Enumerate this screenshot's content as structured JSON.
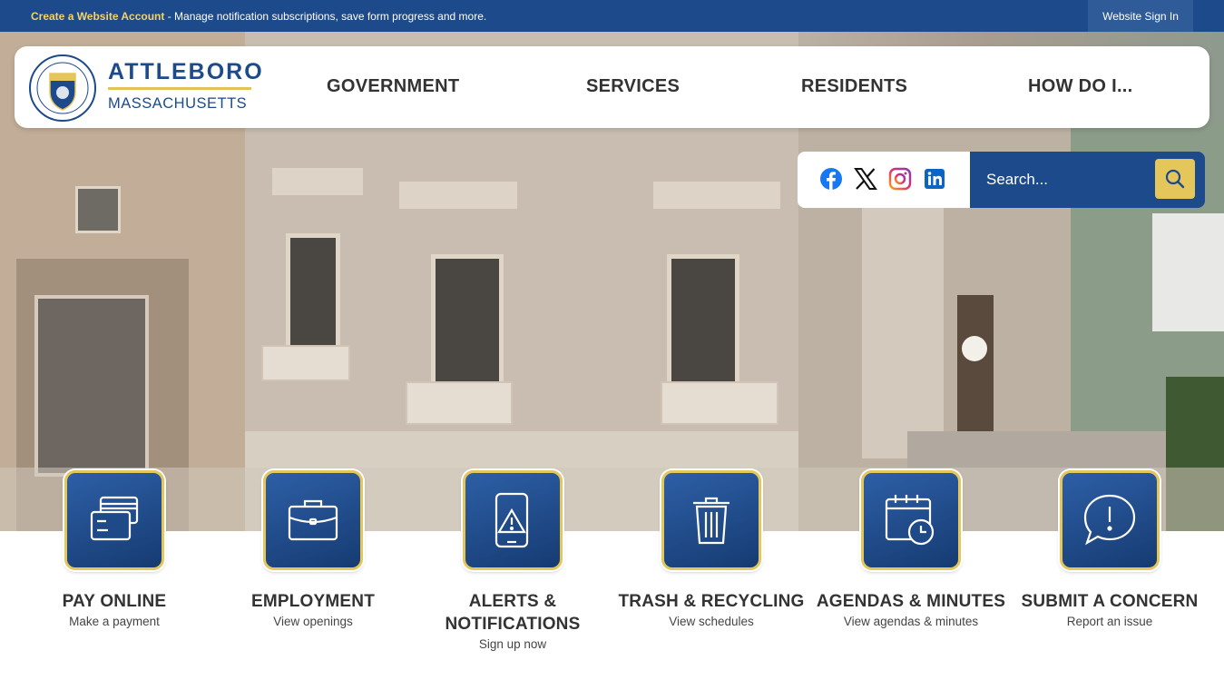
{
  "topbar": {
    "create_link": "Create a Website Account",
    "message": " - Manage notification subscriptions, save form progress and more.",
    "signin": "Website Sign In"
  },
  "brand": {
    "name": "ATTLEBORO",
    "state": "MASSACHUSETTS"
  },
  "nav": [
    "GOVERNMENT",
    "SERVICES",
    "RESIDENTS",
    "HOW DO I..."
  ],
  "social": [
    "facebook-icon",
    "x-icon",
    "instagram-icon",
    "linkedin-icon"
  ],
  "search": {
    "placeholder": "Search..."
  },
  "quicklinks": [
    {
      "title": "PAY ONLINE",
      "sub": "Make a payment",
      "icon": "credit-card-icon"
    },
    {
      "title": "EMPLOYMENT",
      "sub": "View openings",
      "icon": "briefcase-icon"
    },
    {
      "title": "ALERTS & NOTIFICATIONS",
      "sub": "Sign up now",
      "icon": "phone-alert-icon"
    },
    {
      "title": "TRASH & RECYCLING",
      "sub": "View schedules",
      "icon": "trash-can-icon"
    },
    {
      "title": "AGENDAS & MINUTES",
      "sub": "View agendas & minutes",
      "icon": "calendar-clock-icon"
    },
    {
      "title": "SUBMIT A CONCERN",
      "sub": "Report an issue",
      "icon": "speech-bubble-alert-icon"
    }
  ],
  "colors": {
    "primary": "#1c4a8a",
    "accent": "#e4c65b"
  }
}
